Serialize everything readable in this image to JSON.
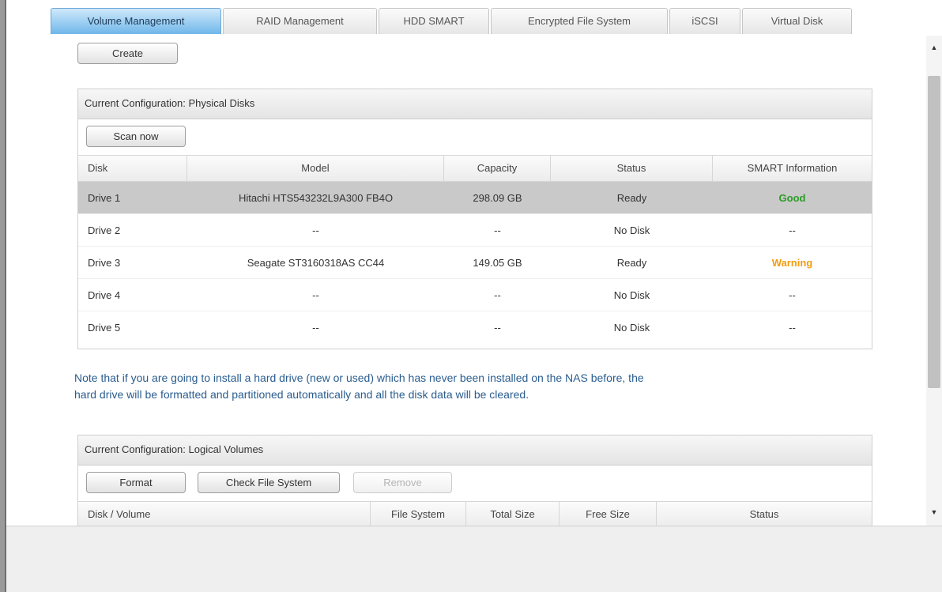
{
  "tabs": [
    {
      "label": "Volume Management",
      "active": true
    },
    {
      "label": "RAID Management",
      "active": false
    },
    {
      "label": "HDD SMART",
      "active": false
    },
    {
      "label": "Encrypted File System",
      "active": false
    },
    {
      "label": "iSCSI",
      "active": false
    },
    {
      "label": "Virtual Disk",
      "active": false
    }
  ],
  "toolbar": {
    "create_label": "Create"
  },
  "physical_disks": {
    "title": "Current Configuration: Physical Disks",
    "scan_label": "Scan now",
    "columns": [
      "Disk",
      "Model",
      "Capacity",
      "Status",
      "SMART Information"
    ],
    "rows": [
      {
        "disk": "Drive 1",
        "model": "Hitachi HTS543232L9A300 FB4O",
        "capacity": "298.09 GB",
        "status": "Ready",
        "smart": "Good",
        "selected": true
      },
      {
        "disk": "Drive 2",
        "model": "--",
        "capacity": "--",
        "status": "No Disk",
        "smart": "--",
        "selected": false
      },
      {
        "disk": "Drive 3",
        "model": "Seagate ST3160318AS CC44",
        "capacity": "149.05 GB",
        "status": "Ready",
        "smart": "Warning",
        "selected": false
      },
      {
        "disk": "Drive 4",
        "model": "--",
        "capacity": "--",
        "status": "No Disk",
        "smart": "--",
        "selected": false
      },
      {
        "disk": "Drive 5",
        "model": "--",
        "capacity": "--",
        "status": "No Disk",
        "smart": "--",
        "selected": false
      }
    ]
  },
  "note": {
    "line1": "Note that if you are going to install a hard drive (new or used) which has never been installed on the NAS before, the",
    "line2": "hard drive will be formatted and partitioned automatically and all the disk data will be cleared."
  },
  "logical_volumes": {
    "title": "Current Configuration: Logical Volumes",
    "format_label": "Format",
    "check_label": "Check File System",
    "remove_label": "Remove",
    "columns": [
      "Disk / Volume",
      "File System",
      "Total Size",
      "Free Size",
      "Status"
    ]
  },
  "colors": {
    "active_tab": "#6fb7ea",
    "good": "#2d9b27",
    "warning": "#f29c11",
    "note_text": "#2a5d8f",
    "selected_row": "#c9c9c9"
  },
  "icons": {
    "scroll_up": "triangle-up-icon",
    "scroll_down": "triangle-down-icon"
  }
}
